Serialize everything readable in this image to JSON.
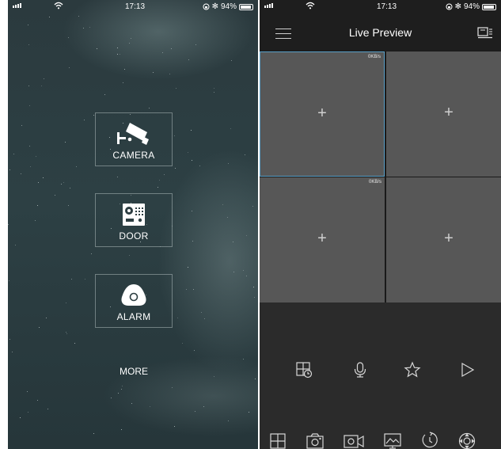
{
  "left_screen": {
    "status_bar": {
      "time": "17:13",
      "battery": "94%"
    },
    "menu": [
      {
        "id": "camera",
        "label": "CAMERA",
        "icon": "camera-icon"
      },
      {
        "id": "door",
        "label": "DOOR",
        "icon": "door-intercom-icon"
      },
      {
        "id": "alarm",
        "label": "ALARM",
        "icon": "alarm-icon"
      }
    ],
    "more_label": "MORE"
  },
  "right_screen": {
    "status_bar": {
      "time": "17:13",
      "battery": "94%"
    },
    "header": {
      "title": "Live Preview",
      "left_icon": "menu-icon",
      "right_icon": "device-list-icon"
    },
    "channels": [
      {
        "rate": "0KB/s",
        "selected": true
      },
      {
        "rate": "0K",
        "selected": false
      },
      {
        "rate": "0KB/s",
        "selected": false
      },
      {
        "rate": "0K",
        "selected": false
      }
    ],
    "toolbar_primary": [
      "playback-split-icon",
      "microphone-icon",
      "favorite-star-icon",
      "play-icon"
    ],
    "toolbar_secondary": [
      "split-screen-icon",
      "snapshot-icon",
      "record-video-icon",
      "image-quality-icon",
      "ptz-rotate-icon",
      "ptz-control-icon"
    ],
    "colors": {
      "selected_border": "#5aa0c8",
      "cell_bg": "#575757",
      "panel_bg": "#2b2b2b"
    }
  }
}
